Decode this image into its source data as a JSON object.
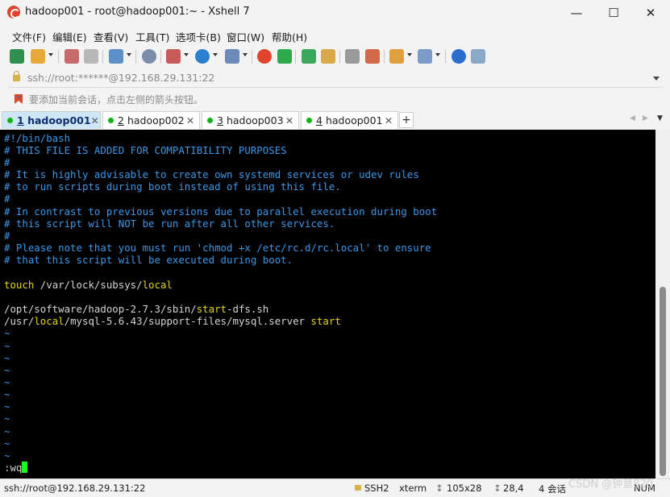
{
  "window": {
    "title": "hadoop001 - root@hadoop001:~ - Xshell 7"
  },
  "menu": [
    "文件(F)",
    "编辑(E)",
    "查看(V)",
    "工具(T)",
    "选项卡(B)",
    "窗口(W)",
    "帮助(H)"
  ],
  "address": {
    "value": "ssh://root:******@192.168.29.131:22"
  },
  "hint": {
    "text": "要添加当前会话，点击左侧的箭头按钮。"
  },
  "tabs": [
    {
      "num": "1",
      "label": "hadoop001",
      "active": true
    },
    {
      "num": "2",
      "label": "hadoop002",
      "active": false
    },
    {
      "num": "3",
      "label": "hadoop003",
      "active": false
    },
    {
      "num": "4",
      "label": "hadoop001",
      "active": false
    }
  ],
  "terminal": {
    "comment_lines": [
      "#!/bin/bash",
      "# THIS FILE IS ADDED FOR COMPATIBILITY PURPOSES",
      "#",
      "# It is highly advisable to create own systemd services or udev rules",
      "# to run scripts during boot instead of using this file.",
      "#",
      "# In contrast to previous versions due to parallel execution during boot",
      "# this script will NOT be run after all other services.",
      "#",
      "# Please note that you must run 'chmod +x /etc/rc.d/rc.local' to ensure",
      "# that this script will be executed during boot."
    ],
    "touch_cmd": "touch",
    "touch_path_a": " /var/lock/subsys/",
    "touch_path_b": "local",
    "line_hadoop_a": "/opt/software/hadoop-2.7.3/sbin/",
    "line_hadoop_b": "start",
    "line_hadoop_c": "-dfs.sh",
    "line_mysql_a": "/usr/",
    "line_mysql_b": "local",
    "line_mysql_c": "/mysql-5.6.43/support-files/mysql.server ",
    "line_mysql_d": "start",
    "tilde": "~",
    "command": ":wq"
  },
  "status": {
    "connection": "ssh://root@192.168.29.131:22",
    "protocol": "SSH2",
    "term": "xterm",
    "size": "105x28",
    "position": "28,4",
    "sessions": "4 会话",
    "num": "NUM"
  },
  "watermark": "CSDN @钟意820",
  "colors": {
    "comment": "#3b97e8",
    "keyword": "#e5d21f",
    "cursor": "#1aff1a",
    "active_tab": "#cfe6f7"
  },
  "icons": [
    "new-session-icon",
    "open-folder-icon",
    "connect-icon",
    "disconnect-icon",
    "new-tab-icon",
    "find-icon",
    "transfer-icon",
    "globe-icon",
    "font-icon",
    "xftp-icon",
    "xmanager-icon",
    "fullscreen-icon",
    "lock-icon",
    "keyboard-icon",
    "highlight-icon",
    "script-icon",
    "layout-icon",
    "help-icon",
    "chat-icon"
  ]
}
